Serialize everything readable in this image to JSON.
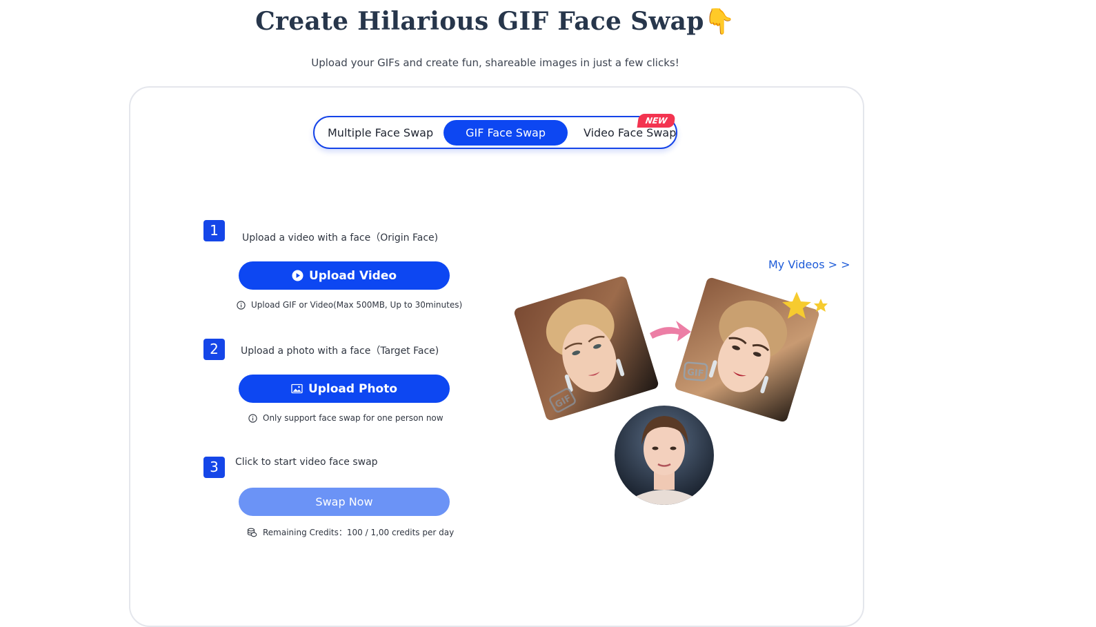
{
  "header": {
    "title": "Create Hilarious GIF Face Swap",
    "title_emoji": "👇",
    "subtitle": "Upload your GIFs and create fun, shareable images in just a few clicks!"
  },
  "tabs": {
    "items": [
      {
        "label": "Multiple Face Swap",
        "active": false
      },
      {
        "label": "GIF Face Swap",
        "active": true
      },
      {
        "label": "Video Face Swap",
        "active": false
      }
    ],
    "badge": "NEW"
  },
  "steps": [
    {
      "number": "1",
      "label": "Upload a video with a face（Origin Face)",
      "button": "Upload Video",
      "button_icon": "play-circle-icon",
      "note": "Upload GIF or Video(Max 500MB, Up to 30minutes)",
      "note_icon": "info-icon"
    },
    {
      "number": "2",
      "label": "Upload a photo with a face（Target Face)",
      "button": "Upload Photo",
      "button_icon": "image-icon",
      "note": "Only support face swap for one person now",
      "note_icon": "info-icon"
    },
    {
      "number": "3",
      "label": "Click to start video face swap",
      "button": "Swap Now",
      "note": "Remaining Credits：100 / 1,00 credits per day",
      "note_icon": "coins-icon"
    }
  ],
  "my_videos_link": "My Videos > >",
  "illustration": {
    "gif_tag": "GIF",
    "arrow_icon": "arrow-right-icon",
    "star_icon": "star-icon"
  },
  "colors": {
    "primary": "#0d47f2",
    "primary_disabled": "#6b93f6",
    "badge": "#f33450",
    "title": "#27364b",
    "link": "#1d5bd8"
  }
}
